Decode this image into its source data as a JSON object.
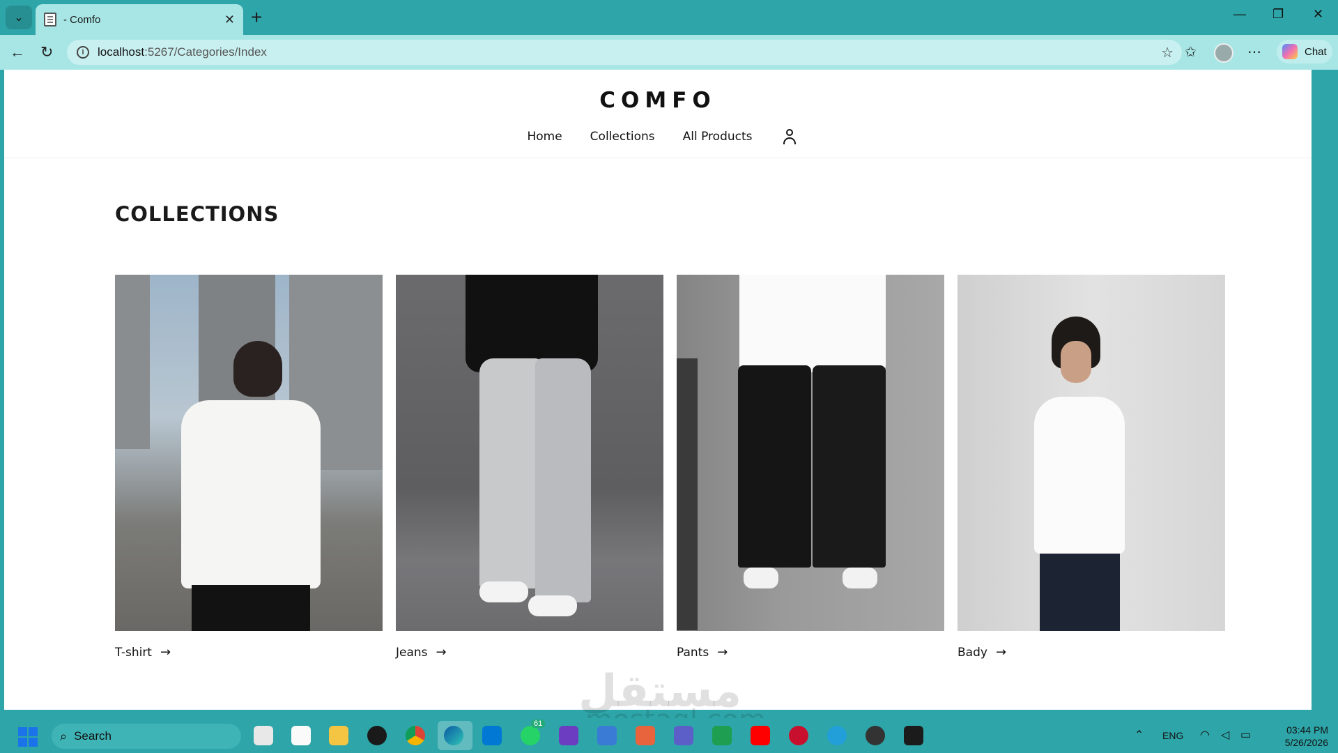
{
  "browser": {
    "tab_title": "- Comfo",
    "tab_close": "✕",
    "new_tab": "+",
    "url_host": "localhost",
    "url_path": ":5267/Categories/Index",
    "chat_label": "Chat"
  },
  "site": {
    "logo": "COMFO",
    "nav": [
      "Home",
      "Collections",
      "All Products"
    ]
  },
  "page": {
    "title": "COLLECTIONS",
    "collections": [
      {
        "label": "T-shirt",
        "arrow": "→"
      },
      {
        "label": "Jeans",
        "arrow": "→"
      },
      {
        "label": "Pants",
        "arrow": "→"
      },
      {
        "label": "Bady",
        "arrow": "→"
      }
    ]
  },
  "watermark": {
    "main": "مستقل",
    "sub": "mostaql.com"
  },
  "taskbar": {
    "search_label": "Search",
    "whatsapp_badge": "61",
    "language": "ENG",
    "time": "03:44 PM",
    "date": "5/26/2026"
  },
  "colors": {
    "chrome": "#2ea5a8",
    "address_bar": "#a8e6e6",
    "page_bg": "#ffffff",
    "text": "#111111"
  }
}
